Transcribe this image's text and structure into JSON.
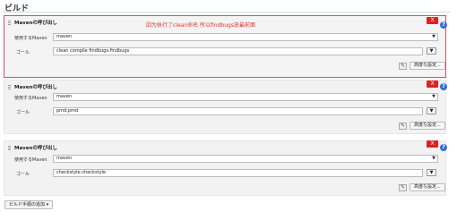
{
  "section": {
    "title": "ビルド"
  },
  "annotation": "因为执行了clean命名 所以findbugs放最前面",
  "steps": [
    {
      "header": "Mavenの呼び出し",
      "maven_label": "使用するMaven",
      "maven_value": "maven",
      "goal_label": "ゴール",
      "goal_value": "clean compile findbugs:findbugs",
      "advanced": "高度な設定...",
      "delete": "X"
    },
    {
      "header": "Mavenの呼び出し",
      "maven_label": "使用するMaven",
      "maven_value": "maven",
      "goal_label": "ゴール",
      "goal_value": "pmd:pmd",
      "advanced": "高度な設定...",
      "delete": "X"
    },
    {
      "header": "Mavenの呼び出し",
      "maven_label": "使用するMaven",
      "maven_value": "maven",
      "goal_label": "ゴール",
      "goal_value": "checkstyle:checkstyle",
      "advanced": "高度な設定...",
      "delete": "X"
    }
  ],
  "add_step_button": "ビルド手順の追加",
  "colors": {
    "annotation": "#e0342c",
    "delete": "#dd2222",
    "help": "#3a6bd8",
    "highlight_border": "#e05050"
  }
}
